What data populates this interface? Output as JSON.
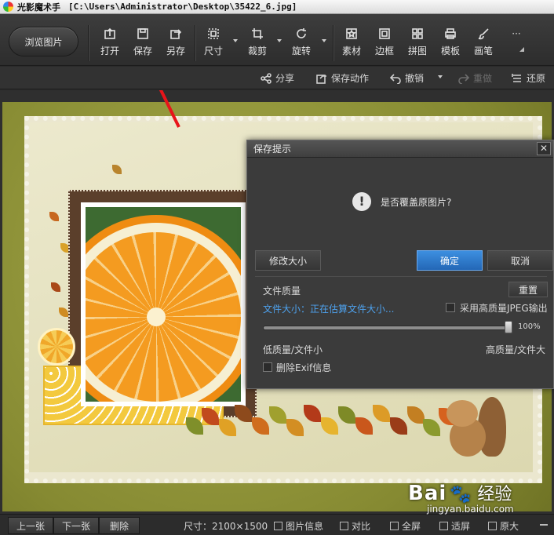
{
  "window": {
    "app_name": "光影魔术手",
    "file_path": "[C:\\Users\\Administrator\\Desktop\\35422_6.jpg]"
  },
  "toolbar": {
    "browse_label": "浏览图片",
    "tools": [
      {
        "label": "打开",
        "icon": "open-icon"
      },
      {
        "label": "保存",
        "icon": "save-icon"
      },
      {
        "label": "另存",
        "icon": "save-as-icon"
      },
      {
        "label": "尺寸",
        "icon": "resize-icon"
      },
      {
        "label": "裁剪",
        "icon": "crop-icon"
      },
      {
        "label": "旋转",
        "icon": "rotate-icon"
      },
      {
        "label": "素材",
        "icon": "material-icon"
      },
      {
        "label": "边框",
        "icon": "border-icon"
      },
      {
        "label": "拼图",
        "icon": "collage-icon"
      },
      {
        "label": "模板",
        "icon": "template-icon"
      },
      {
        "label": "画笔",
        "icon": "brush-icon"
      }
    ],
    "more": "···"
  },
  "actionbar": {
    "share": "分享",
    "save_action": "保存动作",
    "undo": "撤销",
    "redo": "重做",
    "restore": "还原"
  },
  "dialog": {
    "title": "保存提示",
    "close": "✕",
    "message": "是否覆盖原图片?",
    "warn_symbol": "!",
    "resize_button": "修改大小",
    "ok_button": "确定",
    "cancel_button": "取消",
    "quality_label": "文件质量",
    "reset_button": "重置",
    "file_size_text": "文件大小：正在估算文件大小...",
    "high_quality_jpeg": "采用高质量JPEG输出",
    "quality_percent": "100%",
    "quality_value": 1.0,
    "low_quality": "低质量/文件小",
    "high_quality": "高质量/文件大",
    "remove_exif": "删除Exif信息"
  },
  "statusbar": {
    "prev": "上一张",
    "next": "下一张",
    "delete": "删除",
    "size_text": "尺寸：2100×1500",
    "image_info": "图片信息",
    "compare": "对比",
    "fullscreen": "全屏",
    "fit": "适屏",
    "original": "原大"
  },
  "watermark": {
    "brand": "Bai",
    "brand_cn": "经验",
    "url": "jingyan.baidu.com"
  },
  "colors": {
    "accent_blue": "#2f7fd2",
    "annotation_red": "#e8141a"
  }
}
